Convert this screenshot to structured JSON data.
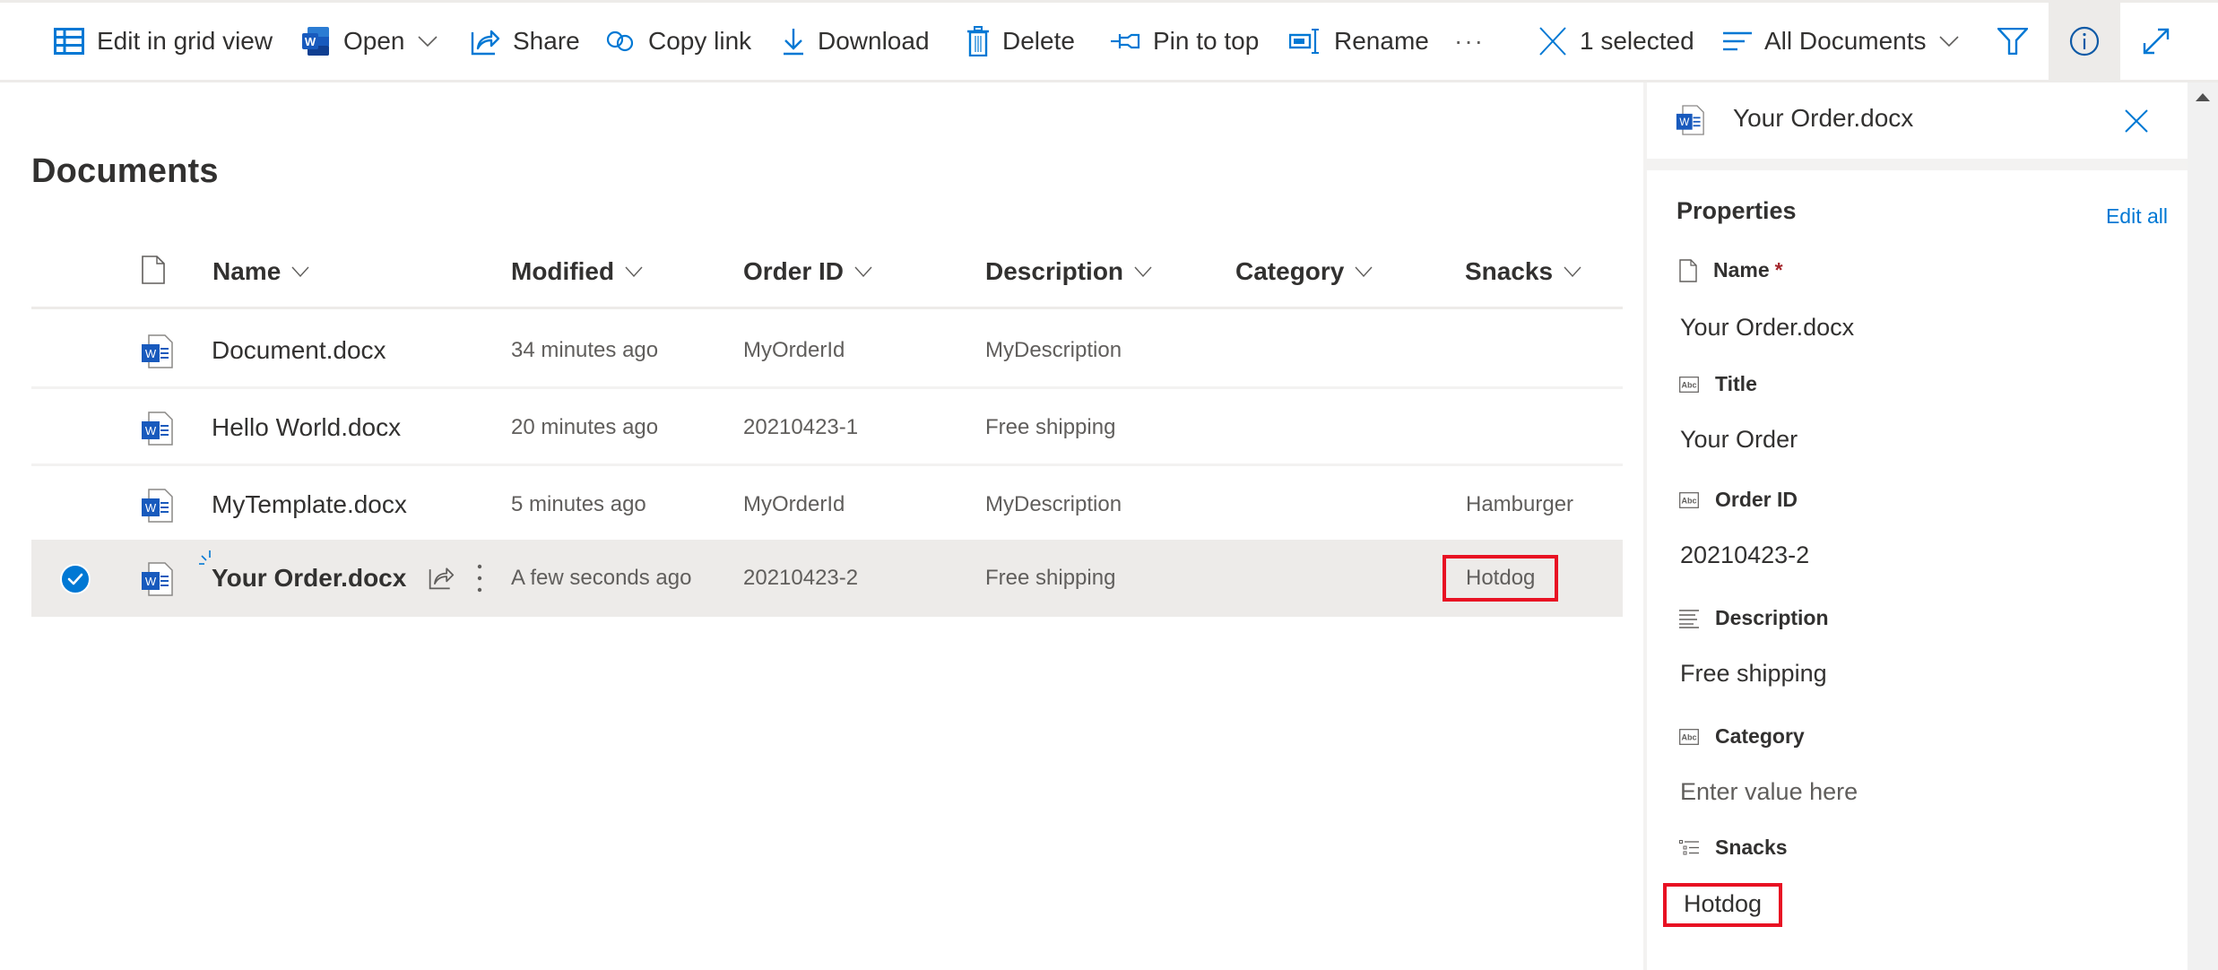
{
  "toolbar": {
    "edit_grid": "Edit in grid view",
    "open": "Open",
    "share": "Share",
    "copy_link": "Copy link",
    "download": "Download",
    "delete": "Delete",
    "pin_to_top": "Pin to top",
    "rename": "Rename",
    "more": "···",
    "selection": "1 selected",
    "view": "All Documents"
  },
  "main": {
    "title": "Documents",
    "columns": [
      "Name",
      "Modified",
      "Order ID",
      "Description",
      "Category",
      "Snacks"
    ],
    "rows": [
      {
        "name": "Document.docx",
        "modified": "34 minutes ago",
        "order_id": "MyOrderId",
        "description": "MyDescription",
        "category": "",
        "snacks": "",
        "selected": false
      },
      {
        "name": "Hello World.docx",
        "modified": "20 minutes ago",
        "order_id": "20210423-1",
        "description": "Free shipping",
        "category": "",
        "snacks": "",
        "selected": false
      },
      {
        "name": "MyTemplate.docx",
        "modified": "5 minutes ago",
        "order_id": "MyOrderId",
        "description": "MyDescription",
        "category": "",
        "snacks": "Hamburger",
        "selected": false
      },
      {
        "name": "Your Order.docx",
        "modified": "A few seconds ago",
        "order_id": "20210423-2",
        "description": "Free shipping",
        "category": "",
        "snacks": "Hotdog",
        "selected": true
      }
    ]
  },
  "panel": {
    "file_name": "Your Order.docx",
    "properties_title": "Properties",
    "edit_all": "Edit all",
    "fields": [
      {
        "label": "Name",
        "required_mark": "*",
        "value": "Your Order.docx",
        "icon": "document-icon"
      },
      {
        "label": "Title",
        "value": "Your Order",
        "icon": "text-field-icon"
      },
      {
        "label": "Order ID",
        "value": "20210423-2",
        "icon": "text-field-icon"
      },
      {
        "label": "Description",
        "value": "Free shipping",
        "icon": "multiline-text-icon"
      },
      {
        "label": "Category",
        "placeholder": "Enter value here",
        "icon": "text-field-icon"
      },
      {
        "label": "Snacks",
        "value": "Hotdog",
        "icon": "choice-list-icon"
      }
    ]
  },
  "colors": {
    "accent": "#0078d4",
    "highlight_box": "#e81123",
    "selected_row": "#edebe9",
    "word_blue": "#185abd"
  }
}
